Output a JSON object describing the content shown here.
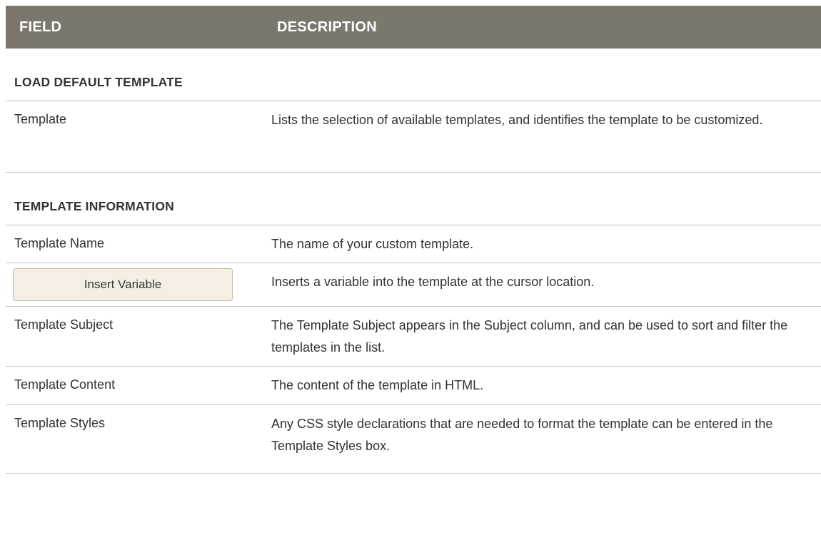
{
  "header": {
    "field": "FIELD",
    "description": "DESCRIPTION"
  },
  "sections": [
    {
      "title": "LOAD DEFAULT TEMPLATE",
      "rows": [
        {
          "field": "Template",
          "description": "Lists the selection of available templates, and identifies the template to be customized."
        }
      ]
    },
    {
      "title": "TEMPLATE INFORMATION",
      "rows": [
        {
          "field": "Template Name",
          "description": "The name of your custom template."
        },
        {
          "field": "Insert Variable",
          "description": "Inserts a variable into the template at the cursor location."
        },
        {
          "field": "Template Subject",
          "description": "The Template Subject appears in the Subject column, and can be used to sort and filter the templates in the list."
        },
        {
          "field": "Template Content",
          "description": "The content of the template in HTML."
        },
        {
          "field": "Template Styles",
          "description": "Any CSS style declarations that are needed to format the template can be entered in the Template Styles box."
        }
      ]
    }
  ]
}
